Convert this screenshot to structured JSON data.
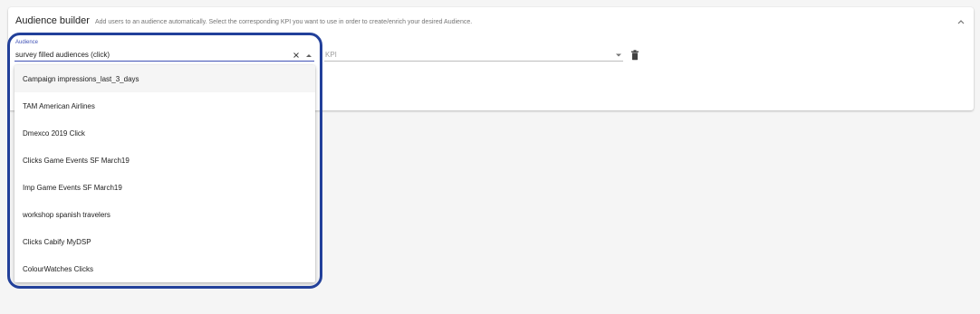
{
  "card": {
    "title": "Audience builder",
    "description": "Add users to an audience automatically. Select the corresponding KPI you want to use in order to create/enrich your desired Audience."
  },
  "audience_field": {
    "label": "Audience",
    "value": "survey filled audiences (click)"
  },
  "kpi_field": {
    "placeholder": "KPI"
  },
  "dropdown": {
    "options": [
      "Campaign impressions_last_3_days",
      "TAM American Airlines",
      "Dmexco 2019 Click",
      "Clicks Game Events SF March19",
      "Imp Game Events SF March19",
      "workshop spanish travelers",
      "Clicks Cabify MyDSP",
      "ColourWatches Clicks"
    ]
  },
  "colors": {
    "accent": "#3f51b5",
    "highlight_border": "#22409a",
    "background": "#f5f5f5"
  },
  "icons": [
    "chevron-up-icon",
    "close-icon",
    "arrow-drop-up-icon",
    "arrow-drop-down-icon",
    "trash-icon"
  ]
}
